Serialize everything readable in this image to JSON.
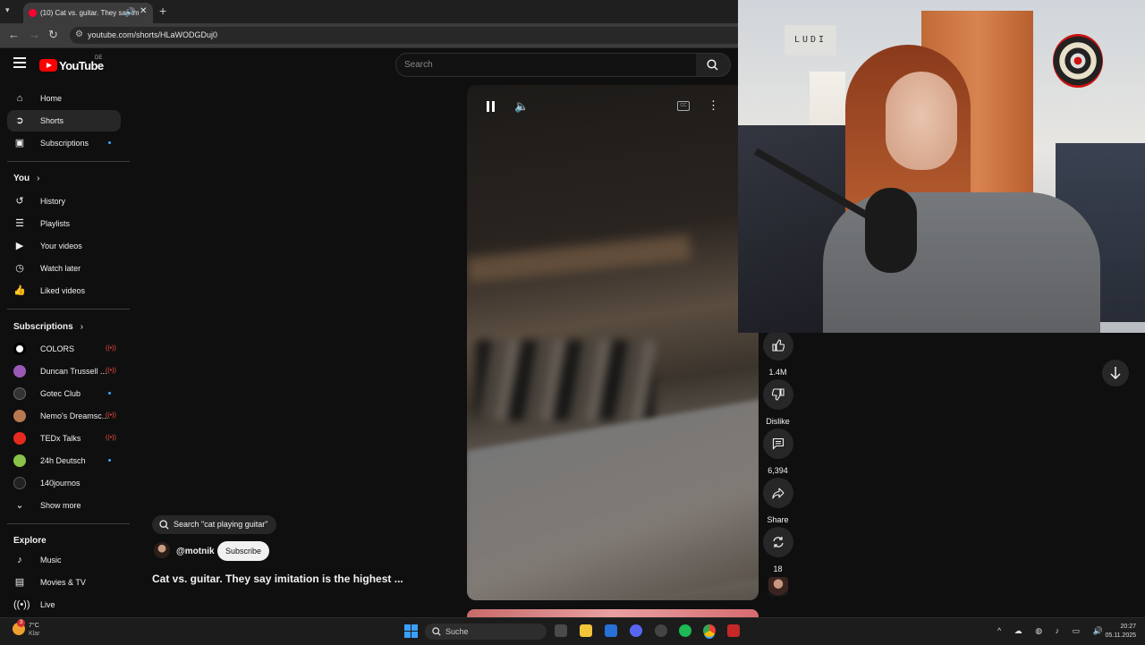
{
  "browser": {
    "tab_title": "(10) Cat vs. guitar. They say imitation is the highest ...",
    "url": "youtube.com/shorts/HLaWODGDuj0"
  },
  "header": {
    "logo_text": "YouTube",
    "country_code": "DE",
    "search_placeholder": "Search"
  },
  "sidebar": {
    "main": [
      {
        "label": "Home",
        "icon": "home-icon"
      },
      {
        "label": "Shorts",
        "icon": "shorts-icon",
        "active": true
      },
      {
        "label": "Subscriptions",
        "icon": "subscriptions-icon"
      }
    ],
    "you_heading": "You",
    "you": [
      {
        "label": "History",
        "icon": "history-icon"
      },
      {
        "label": "Playlists",
        "icon": "playlists-icon"
      },
      {
        "label": "Your videos",
        "icon": "your-videos-icon"
      },
      {
        "label": "Watch later",
        "icon": "watch-later-icon"
      },
      {
        "label": "Liked videos",
        "icon": "liked-videos-icon"
      }
    ],
    "subscriptions_heading": "Subscriptions",
    "subscriptions": [
      {
        "label": "COLORS",
        "color": "#ffffff",
        "status": "live"
      },
      {
        "label": "Duncan Trussell ...",
        "color": "#9b59b6",
        "status": "live"
      },
      {
        "label": "Gotec Club",
        "color": "#333333",
        "status": "new"
      },
      {
        "label": "Nemo's Dreamsc...",
        "color": "#b87850",
        "status": "live"
      },
      {
        "label": "TEDx Talks",
        "color": "#e62b1e",
        "status": "live"
      },
      {
        "label": "24h Deutsch",
        "color": "#8bc34a",
        "status": "new"
      },
      {
        "label": "140journos",
        "color": "#222222",
        "status": ""
      }
    ],
    "show_more": "Show more",
    "explore_heading": "Explore",
    "explore": [
      {
        "label": "Music",
        "icon": "music-icon"
      },
      {
        "label": "Movies & TV",
        "icon": "movies-icon"
      },
      {
        "label": "Live",
        "icon": "live-icon"
      }
    ]
  },
  "short": {
    "related_search": "Search \"cat playing guitar\"",
    "channel": "@motnik",
    "subscribe_label": "Subscribe",
    "title": "Cat vs. guitar. They say imitation is the highest ..."
  },
  "actions": {
    "likes": "1.4M",
    "dislike_label": "Dislike",
    "comments": "6,394",
    "share_label": "Share",
    "remix": "18"
  },
  "webcam": {
    "sign_text": "LUDI"
  },
  "taskbar": {
    "weather_badge": "3",
    "temperature": "7°C",
    "weather_desc": "Klar",
    "search_label": "Suche",
    "time": "20:27",
    "date": "05.11.2025"
  },
  "colors": {
    "accent_red": "#ff0000",
    "background": "#0f0f0f",
    "live_red": "#ff4e45",
    "new_dot": "#3ea6ff"
  }
}
